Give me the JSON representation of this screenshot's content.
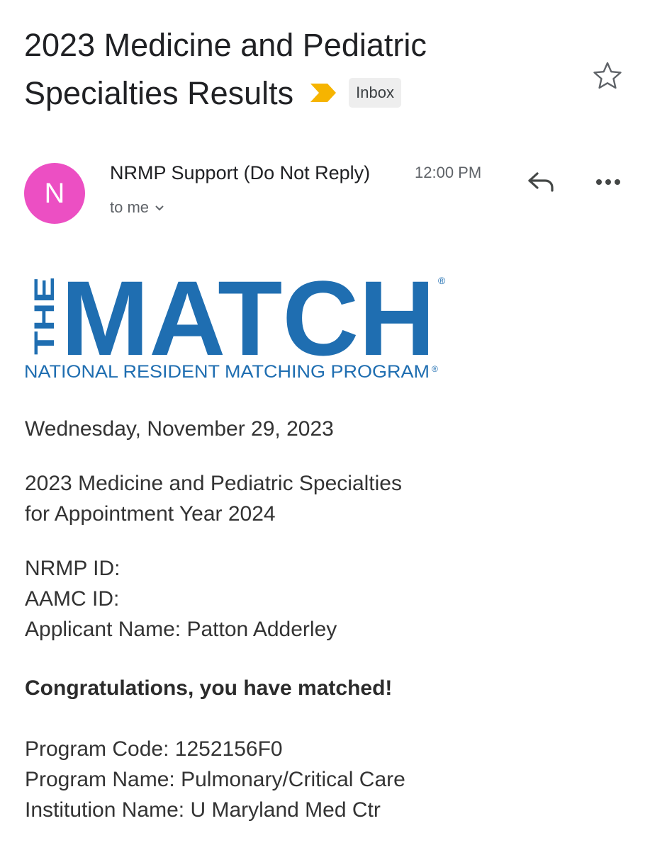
{
  "email": {
    "subject": "2023 Medicine and Pediatric Specialties Results",
    "label": "Inbox",
    "sender": {
      "avatar_letter": "N",
      "name": "NRMP Support (Do Not Reply)",
      "time": "12:00 PM",
      "recipient": "to me"
    },
    "icons": {
      "importance": "importance-marker-icon",
      "star": "star-icon",
      "reply": "reply-icon",
      "more": "more-options-icon",
      "recipient_details": "chevron-down-icon"
    },
    "colors": {
      "avatar": "#ec4fc3",
      "importance_marker": "#f6b400",
      "logo_blue": "#1f6eb1"
    }
  },
  "logo": {
    "the": "THE",
    "match": "MATCH",
    "tagline": "NATIONAL RESIDENT MATCHING PROGRAM",
    "registered": "®"
  },
  "body": {
    "date": "Wednesday, November 29, 2023",
    "title_line1": "2023 Medicine and Pediatric Specialties",
    "title_line2": "for Appointment Year 2024",
    "nrmp_id_label": "NRMP ID:",
    "aamc_id_label": "AAMC ID:",
    "applicant_label": "Applicant Name:",
    "applicant_name": "Patton Adderley",
    "congrats": "Congratulations, you have matched!",
    "program_code_label": "Program Code:",
    "program_code": "1252156F0",
    "program_name_label": "Program Name:",
    "program_name": "Pulmonary/Critical Care",
    "institution_label": "Institution Name:",
    "institution_name": "U Maryland Med Ctr"
  }
}
